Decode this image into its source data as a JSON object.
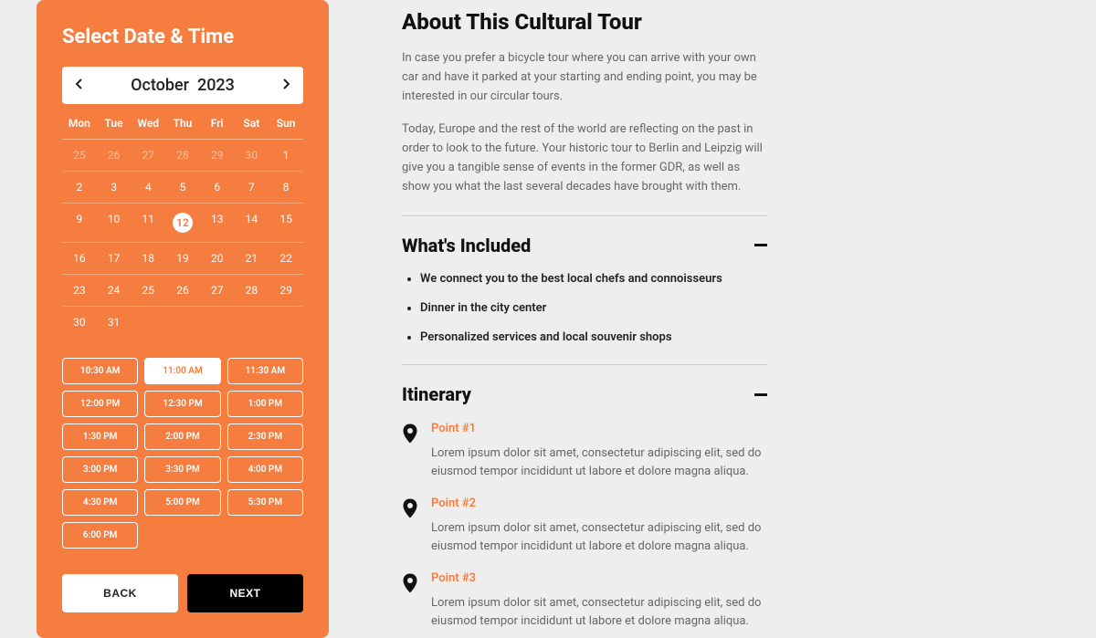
{
  "datepicker": {
    "title": "Select Date & Time",
    "month": "October",
    "year": "2023",
    "weekdays": [
      "Mon",
      "Tue",
      "Wed",
      "Thu",
      "Fri",
      "Sat",
      "Sun"
    ],
    "selected_day": 12,
    "prev_month_days": [
      25,
      26,
      27,
      28,
      29,
      30
    ],
    "month_days": [
      1,
      2,
      3,
      4,
      5,
      6,
      7,
      8,
      9,
      10,
      11,
      12,
      13,
      14,
      15,
      16,
      17,
      18,
      19,
      20,
      21,
      22,
      23,
      24,
      25,
      26,
      27,
      28,
      29,
      30,
      31
    ],
    "times": [
      "10:30 AM",
      "11:00 AM",
      "11:30 AM",
      "12:00 PM",
      "12:30 PM",
      "1:00 PM",
      "1:30 PM",
      "2:00 PM",
      "2:30 PM",
      "3:00 PM",
      "3:30 PM",
      "4:00 PM",
      "4:30 PM",
      "5:00 PM",
      "5:30 PM",
      "6:00 PM"
    ],
    "selected_time": "11:00 AM",
    "back_label": "BACK",
    "next_label": "NEXT"
  },
  "about": {
    "title": "About This Cultural Tour",
    "p1": "In case you prefer a bicycle tour where you can arrive with your own car and have it parked at your starting and ending point, you may be interested in our circular tours.",
    "p2": "Today, Europe and the rest of the world are reflecting on the past in order to look to the future. Your historic tour to Berlin and Leipzig will give you a tangible sense of events in the former GDR, as well as show you what the last several decades have brought with them."
  },
  "included": {
    "title": "What's Included",
    "items": [
      "We connect you to the best local chefs and connoisseurs",
      "Dinner in the city center",
      "Personalized services and local souvenir shops"
    ]
  },
  "itinerary": {
    "title": "Itinerary",
    "points": [
      {
        "title": "Point #1",
        "desc": "Lorem ipsum dolor sit amet, consectetur adipiscing elit, sed do eiusmod tempor incididunt ut labore et dolore magna aliqua."
      },
      {
        "title": "Point #2",
        "desc": "Lorem ipsum dolor sit amet, consectetur adipiscing elit, sed do eiusmod tempor incididunt ut labore et dolore magna aliqua."
      },
      {
        "title": "Point #3",
        "desc": "Lorem ipsum dolor sit amet, consectetur adipiscing elit, sed do eiusmod tempor incididunt ut labore et dolore magna aliqua."
      }
    ]
  }
}
